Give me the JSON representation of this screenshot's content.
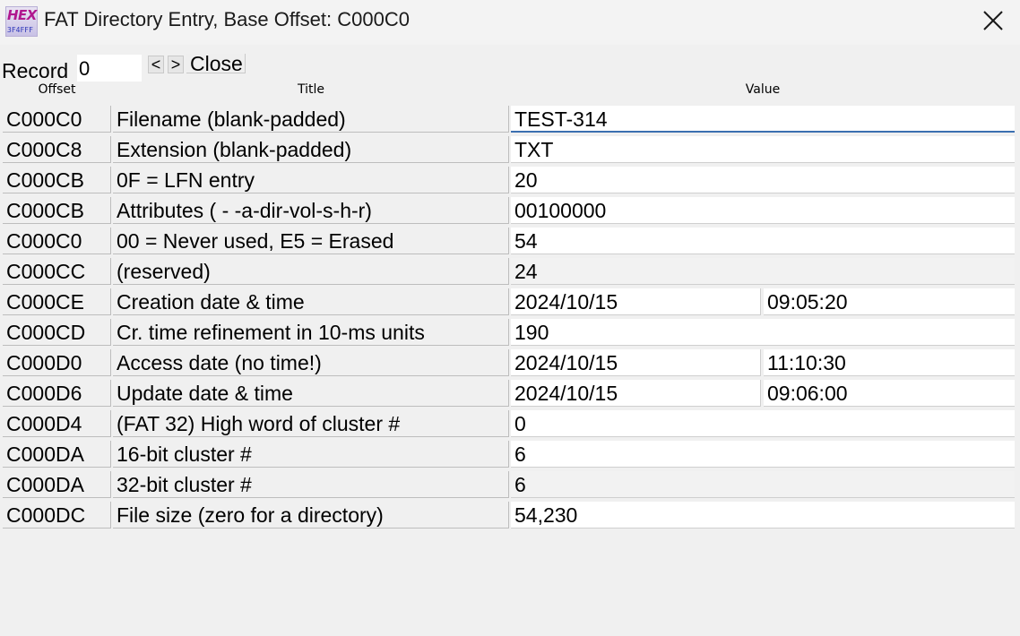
{
  "window": {
    "title": "FAT Directory Entry, Base Offset: C000C0",
    "app_icon_text": "HEX",
    "app_icon_subtext": "3F4FFF",
    "close_icon": "close-x-icon"
  },
  "toolbar": {
    "record_label": "Record",
    "record_value": "0",
    "prev_label": "<",
    "next_label": ">",
    "close_label": "Close"
  },
  "table": {
    "headers": {
      "offset": "Offset",
      "title": "Title",
      "value": "Value"
    },
    "rows": [
      {
        "offset": "C000C0",
        "title": "Filename (blank-padded)",
        "value": "TEST-314"
      },
      {
        "offset": "C000C8",
        "title": "Extension (blank-padded)",
        "value": "TXT"
      },
      {
        "offset": "C000CB",
        "title": "0F = LFN entry",
        "value": "20"
      },
      {
        "offset": "C000CB",
        "title": "Attributes ( - -a-dir-vol-s-h-r)",
        "value": "00100000"
      },
      {
        "offset": "C000C0",
        "title": "00 = Never used, E5 = Erased",
        "value": "54"
      },
      {
        "offset": "C000CC",
        "title": "(reserved)",
        "value": "24"
      },
      {
        "offset": "C000CE",
        "title": "Creation date & time",
        "value": "2024/10/15",
        "value2": "09:05:20"
      },
      {
        "offset": "C000CD",
        "title": "Cr. time refinement in 10-ms units",
        "value": "190"
      },
      {
        "offset": "C000D0",
        "title": "Access date (no time!)",
        "value": "2024/10/15",
        "value2": "11:10:30"
      },
      {
        "offset": "C000D6",
        "title": "Update date & time",
        "value": "2024/10/15",
        "value2": "09:06:00"
      },
      {
        "offset": "C000D4",
        "title": "(FAT 32) High word of cluster #",
        "value": "0"
      },
      {
        "offset": "C000DA",
        "title": "16-bit cluster #",
        "value": "6"
      },
      {
        "offset": "C000DA",
        "title": "32-bit cluster #",
        "value": "6"
      },
      {
        "offset": "C000DC",
        "title": "File size (zero for a directory)",
        "value": "54,230"
      }
    ]
  },
  "colors": {
    "background": "#f0f0f0",
    "value_cell": "#ffffff",
    "focus_underline": "#3b6fb0",
    "icon_hex": "#b0178e",
    "icon_sub": "#2a33b8"
  }
}
